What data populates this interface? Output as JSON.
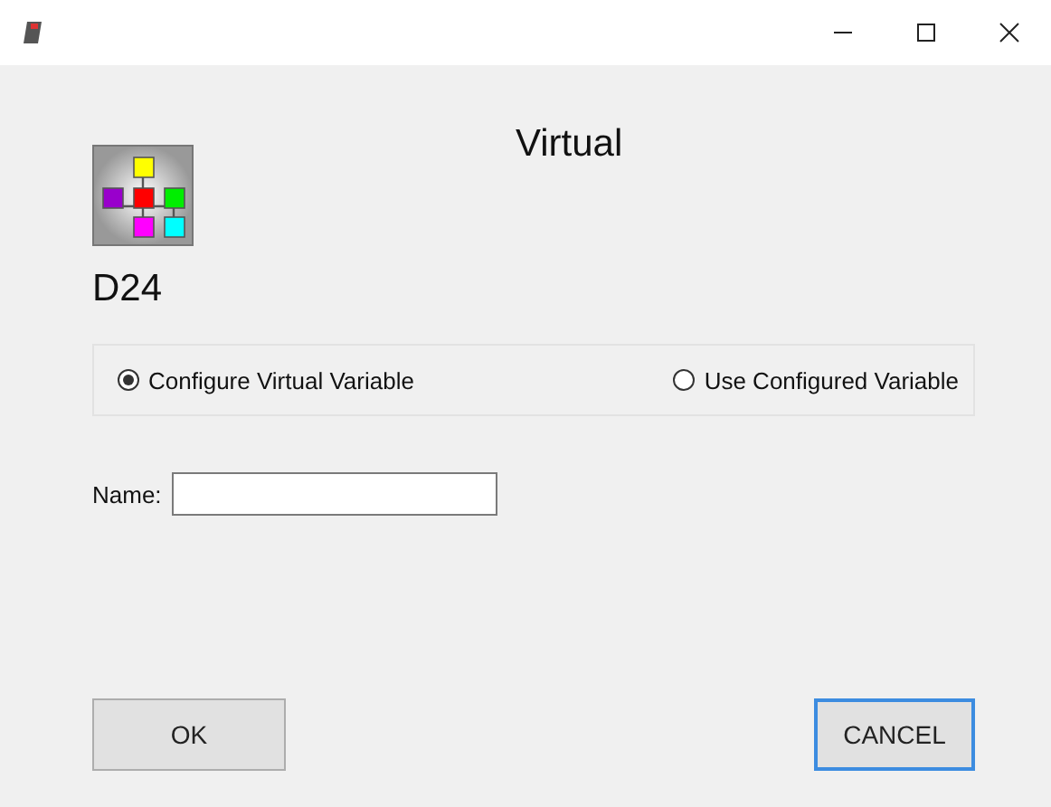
{
  "header": {
    "heading": "Virtual",
    "code": "D24"
  },
  "mode_options": [
    {
      "label": "Configure Virtual Variable",
      "selected": true
    },
    {
      "label": "Use Configured Variable",
      "selected": false
    }
  ],
  "name_field": {
    "label": "Name:"
  },
  "buttons": [
    {
      "label": "OK",
      "focused": false
    },
    {
      "label": "CANCEL",
      "focused": true
    }
  ]
}
